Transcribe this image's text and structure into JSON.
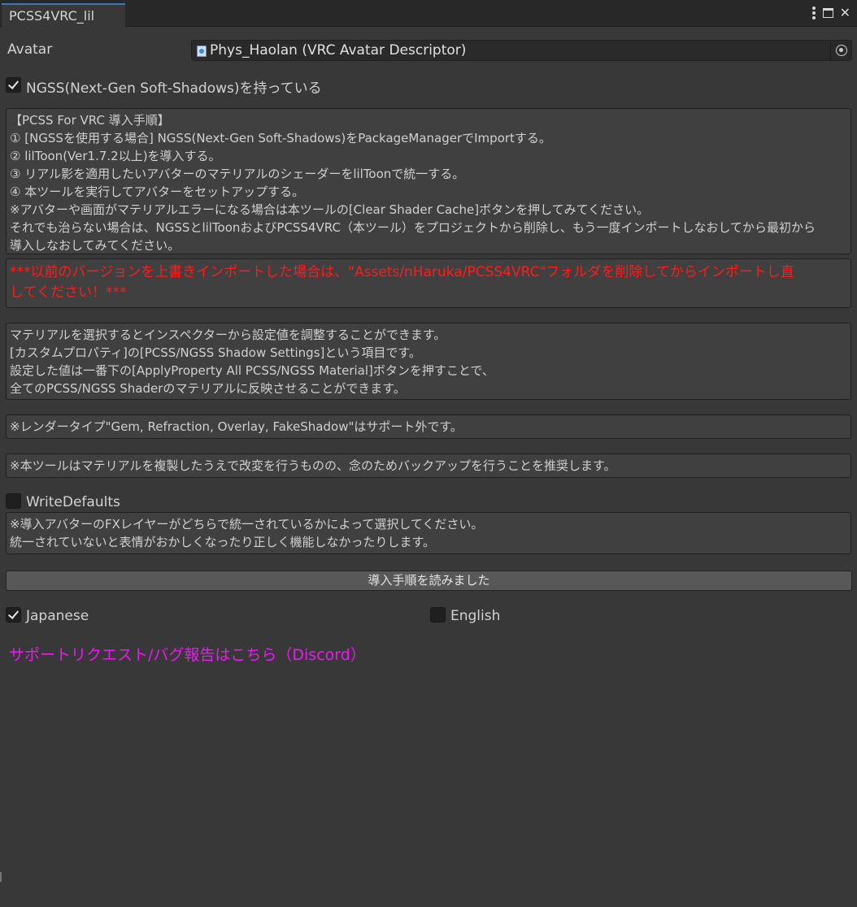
{
  "window": {
    "tab_title": "PCSS4VRC_lil",
    "controls": [
      "kebab-menu-icon",
      "maximize-icon",
      "close-icon"
    ],
    "close_glyph": "✕"
  },
  "avatar": {
    "label": "Avatar",
    "value": "Phys_Haolan (VRC Avatar Descriptor)",
    "icon": "avatar-descriptor-icon",
    "picker_icon": "object-picker-icon"
  },
  "ngss": {
    "label": "NGSS(Next-Gen Soft-Shadows)を持っている",
    "checked": true
  },
  "instructions": {
    "lines": [
      "【PCSS For VRC 導入手順】",
      "① [NGSSを使用する場合] NGSS(Next-Gen Soft-Shadows)をPackageManagerでImportする。",
      "② lilToon(Ver1.7.2以上)を導入する。",
      "③ リアル影を適用したいアバターのマテリアルのシェーダーをlilToonで統一する。",
      "④ 本ツールを実行してアバターをセットアップする。",
      "※アバターや画面がマテリアルエラーになる場合は本ツールの[Clear Shader Cache]ボタンを押してみてください。",
      "それでも治らない場合は、NGSSとlilToonおよびPCSS4VRC（本ツール）をプロジェクトから削除し、もう一度インポートしなおしてから最初から",
      "導入しなおしてみてください。"
    ]
  },
  "warning": {
    "lines": [
      "***以前のバージョンを上書きインポートした場合は、\"Assets/nHaruka/PCSS4VRC\"フォルダを削除してからインポートし直",
      "してください！***"
    ],
    "color": "#ff1c1c"
  },
  "material_info": {
    "lines": [
      "マテリアルを選択するとインスペクターから設定値を調整することができます。",
      "[カスタムプロパティ]の[PCSS/NGSS Shadow Settings]という項目です。",
      "設定した値は一番下の[ApplyProperty All PCSS/NGSS Material]ボタンを押すことで、",
      "全てのPCSS/NGSS Shaderのマテリアルに反映させることができます。"
    ]
  },
  "render_type_note": "※レンダータイプ\"Gem, Refraction, Overlay, FakeShadow\"はサポート外です。",
  "backup_note": "※本ツールはマテリアルを複製したうえで改変を行うものの、念のためバックアップを行うことを推奨します。",
  "write_defaults": {
    "label": "WriteDefaults",
    "checked": false,
    "note_lines": [
      "※導入アバターのFXレイヤーがどちらで統一されているかによって選択してください。",
      "統一されていないと表情がおかしくなったり正しく機能しなかったりします。"
    ]
  },
  "read_button": "導入手順を読みました",
  "language": {
    "japanese": {
      "label": "Japanese",
      "checked": true
    },
    "english": {
      "label": "English",
      "checked": false
    }
  },
  "support_link": {
    "text": "サポートリクエスト/バグ報告はこちら（Discord）",
    "color": "#e81cf0"
  },
  "colors": {
    "background": "#383838",
    "tab_accent": "#3a79bb",
    "helpbox": "#404040"
  }
}
